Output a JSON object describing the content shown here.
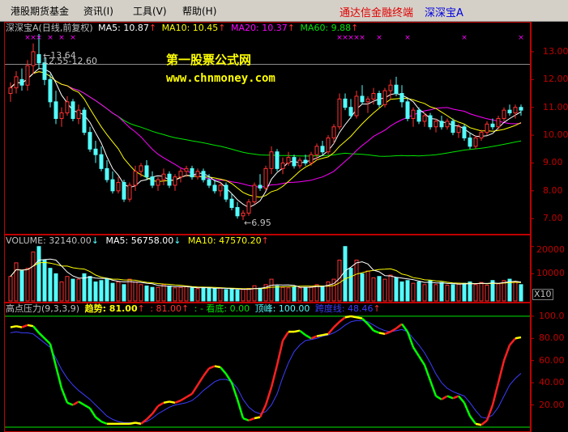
{
  "menu": {
    "items": [
      {
        "label": "港股期货基金"
      },
      {
        "label": "资讯(I)"
      },
      {
        "label": "工具(V)"
      },
      {
        "label": "帮助(H)"
      }
    ],
    "brand": "通达信金融终端",
    "stock": "深深宝A"
  },
  "price_panel": {
    "name": "深深宝A",
    "period": "(日线,前复权)",
    "ma5": "MA5: 10.87",
    "ma10": "MA10: 10.45",
    "ma20": "MA20: 10.37",
    "ma60": "MA60: 9.88",
    "high_label": "13.64",
    "range_label": "12.55-12.60",
    "low_label": "6.95",
    "watermark_cn": "第一股票公式网",
    "watermark_url": "www.chnmoney.com",
    "axis": [
      "13.00",
      "12.00",
      "11.00",
      "10.00",
      "9.00",
      "8.00",
      "7.00"
    ]
  },
  "volume_panel": {
    "volume": "VOLUME: 32140.00",
    "ma5": "MA5: 56758.00",
    "ma10": "MA10: 47570.20",
    "axis": [
      "20000",
      "10000"
    ],
    "unit": "X10"
  },
  "indicator_panel": {
    "name": "高点压力(9,3,3,9)",
    "trend": "趋势: 81.00",
    "val2": ": 81.00",
    "kandi": ": - 看底: 0.00",
    "dingfeng": "顶峰: 100.00",
    "line": "跨度线: 48.46",
    "axis": [
      "100.0",
      "80.00",
      "60.00",
      "40.00",
      "20.00"
    ]
  },
  "colors": {
    "up": "#ff3232",
    "down": "#54fcfc",
    "ma5": "#ffffff",
    "ma10": "#ffff00",
    "ma20": "#ff00ff",
    "ma60": "#00e600",
    "axis_red": "#c00000"
  },
  "chart_data": {
    "type": "candlestick",
    "title": "深深宝A (日线,前复权)",
    "price_ylim": [
      6.6,
      13.9
    ],
    "volume_ylim": [
      0,
      22000
    ],
    "indicator_ylim": [
      0,
      105
    ],
    "candles": [
      {
        "o": 11.5,
        "h": 11.9,
        "l": 11.2,
        "c": 11.7
      },
      {
        "o": 11.7,
        "h": 12.3,
        "l": 11.5,
        "c": 12.1
      },
      {
        "o": 12.0,
        "h": 12.4,
        "l": 11.6,
        "c": 11.8
      },
      {
        "o": 11.8,
        "h": 12.7,
        "l": 11.6,
        "c": 12.5
      },
      {
        "o": 12.5,
        "h": 13.3,
        "l": 12.2,
        "c": 13.0
      },
      {
        "o": 12.9,
        "h": 13.64,
        "l": 12.4,
        "c": 12.6
      },
      {
        "o": 12.6,
        "h": 12.8,
        "l": 11.8,
        "c": 12.0
      },
      {
        "o": 12.0,
        "h": 12.2,
        "l": 11.0,
        "c": 11.2
      },
      {
        "o": 11.2,
        "h": 11.6,
        "l": 10.4,
        "c": 10.6
      },
      {
        "o": 10.6,
        "h": 11.0,
        "l": 10.3,
        "c": 10.8
      },
      {
        "o": 10.8,
        "h": 11.4,
        "l": 10.7,
        "c": 11.2
      },
      {
        "o": 11.2,
        "h": 11.3,
        "l": 10.5,
        "c": 10.6
      },
      {
        "o": 10.6,
        "h": 11.1,
        "l": 10.4,
        "c": 10.9
      },
      {
        "o": 10.9,
        "h": 11.0,
        "l": 10.0,
        "c": 10.1
      },
      {
        "o": 10.1,
        "h": 10.3,
        "l": 9.4,
        "c": 9.5
      },
      {
        "o": 9.5,
        "h": 9.8,
        "l": 9.0,
        "c": 9.3
      },
      {
        "o": 9.3,
        "h": 9.6,
        "l": 8.7,
        "c": 8.8
      },
      {
        "o": 8.8,
        "h": 9.1,
        "l": 8.3,
        "c": 8.4
      },
      {
        "o": 8.4,
        "h": 8.7,
        "l": 7.9,
        "c": 8.0
      },
      {
        "o": 8.0,
        "h": 8.5,
        "l": 7.9,
        "c": 8.3
      },
      {
        "o": 8.3,
        "h": 8.4,
        "l": 7.6,
        "c": 7.7
      },
      {
        "o": 7.7,
        "h": 8.3,
        "l": 7.6,
        "c": 8.2
      },
      {
        "o": 8.2,
        "h": 8.9,
        "l": 8.0,
        "c": 8.7
      },
      {
        "o": 8.7,
        "h": 9.0,
        "l": 8.5,
        "c": 8.9
      },
      {
        "o": 8.9,
        "h": 9.1,
        "l": 8.4,
        "c": 8.5
      },
      {
        "o": 8.5,
        "h": 8.7,
        "l": 8.1,
        "c": 8.2
      },
      {
        "o": 8.2,
        "h": 8.5,
        "l": 8.0,
        "c": 8.4
      },
      {
        "o": 8.4,
        "h": 8.8,
        "l": 8.2,
        "c": 8.6
      },
      {
        "o": 8.6,
        "h": 8.7,
        "l": 8.1,
        "c": 8.2
      },
      {
        "o": 8.2,
        "h": 8.6,
        "l": 8.0,
        "c": 8.5
      },
      {
        "o": 8.5,
        "h": 8.8,
        "l": 8.3,
        "c": 8.7
      },
      {
        "o": 8.7,
        "h": 8.9,
        "l": 8.5,
        "c": 8.8
      },
      {
        "o": 8.8,
        "h": 8.9,
        "l": 8.4,
        "c": 8.5
      },
      {
        "o": 8.5,
        "h": 8.8,
        "l": 8.4,
        "c": 8.7
      },
      {
        "o": 8.7,
        "h": 8.8,
        "l": 8.3,
        "c": 8.4
      },
      {
        "o": 8.4,
        "h": 8.6,
        "l": 8.1,
        "c": 8.2
      },
      {
        "o": 8.2,
        "h": 8.4,
        "l": 7.9,
        "c": 8.0
      },
      {
        "o": 8.0,
        "h": 8.3,
        "l": 7.8,
        "c": 8.2
      },
      {
        "o": 8.2,
        "h": 8.3,
        "l": 7.6,
        "c": 7.7
      },
      {
        "o": 7.7,
        "h": 7.9,
        "l": 7.3,
        "c": 7.4
      },
      {
        "o": 7.4,
        "h": 7.6,
        "l": 7.0,
        "c": 7.1
      },
      {
        "o": 7.1,
        "h": 7.3,
        "l": 6.95,
        "c": 7.2
      },
      {
        "o": 7.2,
        "h": 7.7,
        "l": 7.1,
        "c": 7.6
      },
      {
        "o": 7.6,
        "h": 8.3,
        "l": 7.5,
        "c": 8.2
      },
      {
        "o": 8.2,
        "h": 8.6,
        "l": 8.0,
        "c": 8.1
      },
      {
        "o": 8.1,
        "h": 8.9,
        "l": 8.0,
        "c": 8.8
      },
      {
        "o": 8.8,
        "h": 9.6,
        "l": 8.6,
        "c": 9.4
      },
      {
        "o": 9.4,
        "h": 9.5,
        "l": 8.7,
        "c": 8.8
      },
      {
        "o": 8.8,
        "h": 9.2,
        "l": 8.6,
        "c": 9.0
      },
      {
        "o": 9.0,
        "h": 9.4,
        "l": 8.9,
        "c": 9.2
      },
      {
        "o": 9.2,
        "h": 9.3,
        "l": 8.8,
        "c": 8.9
      },
      {
        "o": 8.9,
        "h": 9.2,
        "l": 8.8,
        "c": 9.1
      },
      {
        "o": 9.1,
        "h": 9.3,
        "l": 8.9,
        "c": 9.0
      },
      {
        "o": 9.0,
        "h": 9.4,
        "l": 8.9,
        "c": 9.3
      },
      {
        "o": 9.3,
        "h": 9.7,
        "l": 9.1,
        "c": 9.6
      },
      {
        "o": 9.6,
        "h": 9.8,
        "l": 9.3,
        "c": 9.4
      },
      {
        "o": 9.4,
        "h": 10.0,
        "l": 9.3,
        "c": 9.9
      },
      {
        "o": 9.9,
        "h": 10.4,
        "l": 9.7,
        "c": 10.3
      },
      {
        "o": 10.3,
        "h": 11.5,
        "l": 10.2,
        "c": 11.3
      },
      {
        "o": 11.3,
        "h": 11.5,
        "l": 10.9,
        "c": 11.0
      },
      {
        "o": 11.0,
        "h": 11.3,
        "l": 10.6,
        "c": 10.7
      },
      {
        "o": 10.7,
        "h": 11.6,
        "l": 10.6,
        "c": 11.4
      },
      {
        "o": 11.4,
        "h": 11.8,
        "l": 11.1,
        "c": 11.2
      },
      {
        "o": 11.2,
        "h": 11.4,
        "l": 10.8,
        "c": 11.3
      },
      {
        "o": 11.3,
        "h": 11.7,
        "l": 11.1,
        "c": 11.5
      },
      {
        "o": 11.5,
        "h": 11.6,
        "l": 11.0,
        "c": 11.1
      },
      {
        "o": 11.1,
        "h": 11.7,
        "l": 11.0,
        "c": 11.6
      },
      {
        "o": 11.6,
        "h": 12.0,
        "l": 11.3,
        "c": 11.8
      },
      {
        "o": 11.8,
        "h": 12.1,
        "l": 11.4,
        "c": 11.5
      },
      {
        "o": 11.5,
        "h": 11.8,
        "l": 11.0,
        "c": 11.2
      },
      {
        "o": 11.2,
        "h": 11.3,
        "l": 10.5,
        "c": 10.6
      },
      {
        "o": 10.6,
        "h": 11.0,
        "l": 10.3,
        "c": 10.9
      },
      {
        "o": 10.9,
        "h": 11.0,
        "l": 10.4,
        "c": 10.5
      },
      {
        "o": 10.5,
        "h": 10.8,
        "l": 10.3,
        "c": 10.7
      },
      {
        "o": 10.7,
        "h": 10.8,
        "l": 10.2,
        "c": 10.3
      },
      {
        "o": 10.3,
        "h": 10.6,
        "l": 10.1,
        "c": 10.5
      },
      {
        "o": 10.5,
        "h": 10.7,
        "l": 10.2,
        "c": 10.3
      },
      {
        "o": 10.3,
        "h": 10.6,
        "l": 10.2,
        "c": 10.5
      },
      {
        "o": 10.5,
        "h": 10.6,
        "l": 10.0,
        "c": 10.1
      },
      {
        "o": 10.1,
        "h": 10.4,
        "l": 9.9,
        "c": 10.3
      },
      {
        "o": 10.3,
        "h": 10.4,
        "l": 9.8,
        "c": 9.9
      },
      {
        "o": 9.9,
        "h": 10.1,
        "l": 9.5,
        "c": 9.6
      },
      {
        "o": 9.6,
        "h": 10.0,
        "l": 9.5,
        "c": 9.9
      },
      {
        "o": 9.9,
        "h": 10.2,
        "l": 9.8,
        "c": 10.1
      },
      {
        "o": 10.1,
        "h": 10.5,
        "l": 10.0,
        "c": 10.4
      },
      {
        "o": 10.4,
        "h": 10.6,
        "l": 10.2,
        "c": 10.3
      },
      {
        "o": 10.3,
        "h": 10.7,
        "l": 10.2,
        "c": 10.6
      },
      {
        "o": 10.6,
        "h": 11.0,
        "l": 10.5,
        "c": 10.9
      },
      {
        "o": 10.9,
        "h": 11.1,
        "l": 10.7,
        "c": 10.8
      },
      {
        "o": 10.8,
        "h": 11.1,
        "l": 10.6,
        "c": 11.0
      },
      {
        "o": 11.0,
        "h": 11.1,
        "l": 10.7,
        "c": 10.9
      }
    ],
    "volume": [
      9000,
      14000,
      11000,
      12000,
      18000,
      20000,
      15000,
      12000,
      10000,
      7000,
      9000,
      8000,
      8000,
      10000,
      9000,
      7000,
      7500,
      8000,
      6500,
      7000,
      6000,
      8000,
      7000,
      6000,
      5500,
      5000,
      5000,
      6000,
      5500,
      4800,
      5000,
      5200,
      4800,
      4500,
      5000,
      4700,
      4500,
      4800,
      4200,
      4300,
      4000,
      4200,
      4600,
      5600,
      4700,
      6000,
      8000,
      5500,
      5000,
      4800,
      5200,
      4800,
      5000,
      5300,
      6000,
      5500,
      7000,
      8000,
      15000,
      20000,
      12000,
      15000,
      10000,
      11000,
      8500,
      9000,
      8000,
      9500,
      8600,
      7000,
      7500,
      6500,
      7000,
      6000,
      7500,
      6000,
      6800,
      5800,
      6000,
      6200,
      6500,
      7000,
      6000,
      6800,
      5800,
      7500,
      6300,
      7500,
      8000,
      7000,
      6000
    ],
    "series": [
      {
        "name": "趋势",
        "values": [
          90,
          91,
          90,
          92,
          91,
          85,
          80,
          75,
          55,
          35,
          22,
          20,
          23,
          20,
          17,
          9,
          5,
          3,
          3,
          3,
          3,
          3,
          4,
          3,
          7,
          12,
          19,
          22,
          23,
          22,
          24,
          27,
          30,
          38,
          46,
          53,
          55,
          54,
          48,
          40,
          25,
          8,
          6,
          8,
          9,
          20,
          36,
          56,
          78,
          86,
          86,
          87,
          83,
          80,
          82,
          83,
          84,
          90,
          95,
          99,
          100,
          99,
          98,
          93,
          87,
          85,
          84,
          86,
          89,
          93,
          86,
          72,
          64,
          56,
          42,
          28,
          25,
          28,
          26,
          28,
          22,
          10,
          3,
          2,
          6,
          20,
          40,
          60,
          74,
          80,
          81
        ]
      },
      {
        "name": "跨度线",
        "values": [
          85,
          86,
          85,
          85,
          84,
          80,
          76,
          72,
          62,
          52,
          44,
          38,
          33,
          29,
          25,
          20,
          15,
          10,
          7,
          5,
          4,
          4,
          4,
          4,
          5,
          8,
          12,
          15,
          18,
          20,
          21,
          22,
          24,
          28,
          33,
          37,
          41,
          43,
          43,
          41,
          35,
          25,
          18,
          14,
          12,
          14,
          20,
          30,
          45,
          58,
          68,
          74,
          78,
          79,
          80,
          82,
          83,
          85,
          88,
          92,
          95,
          96,
          96,
          95,
          92,
          89,
          87,
          86,
          87,
          88,
          86,
          80,
          74,
          67,
          58,
          48,
          40,
          35,
          32,
          30,
          28,
          22,
          15,
          9,
          8,
          11,
          18,
          28,
          38,
          44,
          48.46
        ]
      }
    ]
  }
}
